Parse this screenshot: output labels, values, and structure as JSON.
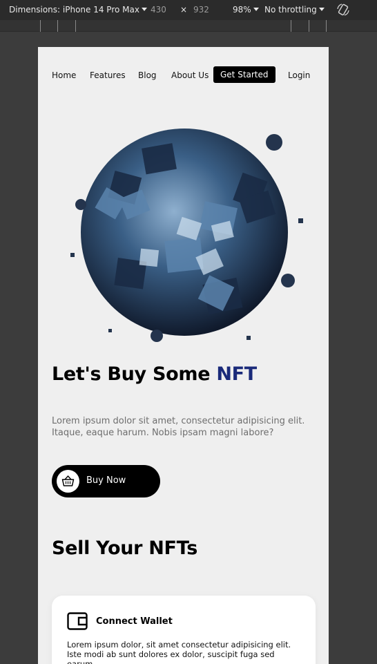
{
  "devtools": {
    "dimensions_label": "Dimensions: iPhone 14 Pro Max",
    "width_value": "430",
    "times": "×",
    "height_value": "932",
    "zoom": "98%",
    "throttling": "No throttling"
  },
  "nav": {
    "items": [
      "Home",
      "Features",
      "Blog",
      "About Us"
    ],
    "cta_label": "Get Started",
    "login_label": "Login"
  },
  "hero": {
    "title_prefix": "Let's Buy Some ",
    "title_accent": "NFT",
    "description": "Lorem ipsum dolor sit amet, consectetur adipisicing elit. Itaque, eaque harum. Nobis ipsam magni labore?",
    "buy_label": "Buy Now"
  },
  "sell": {
    "heading": "Sell Your NFTs",
    "card_title": "Connect Wallet",
    "card_body": "Lorem ipsum dolor, sit amet consectetur adipisicing elit. Iste modi ab sunt dolores ex dolor, suscipit fuga sed earum."
  },
  "colors": {
    "accent": "#1a2a7a",
    "page_bg": "#efefef",
    "button_bg": "#000000"
  }
}
